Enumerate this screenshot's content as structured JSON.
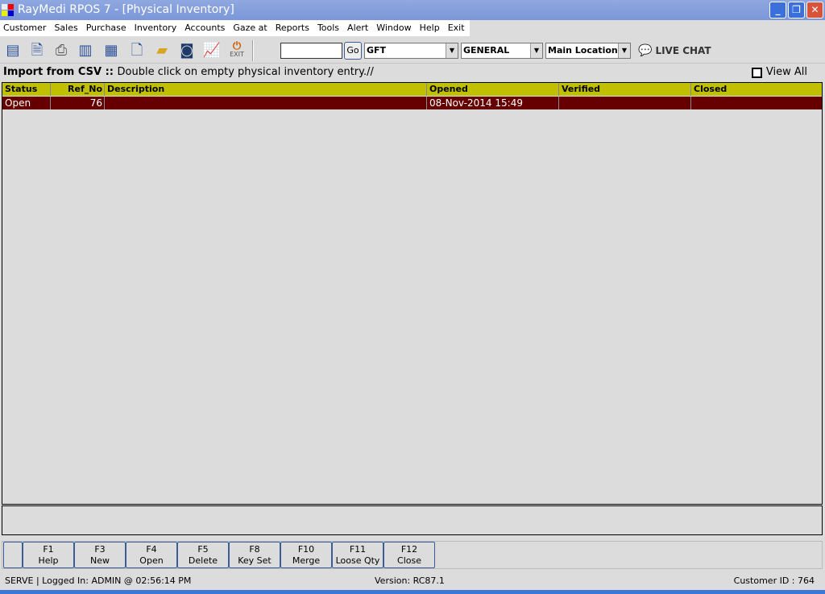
{
  "window": {
    "title": "RayMedi RPOS 7 - [Physical Inventory]"
  },
  "menu": [
    "Customer",
    "Sales",
    "Purchase",
    "Inventory",
    "Accounts",
    "Gaze at",
    "Reports",
    "Tools",
    "Alert",
    "Window",
    "Help",
    "Exit"
  ],
  "toolbar": {
    "exit_label": "EXIT",
    "search_value": "",
    "go_label": "Go",
    "combo1": "GFT",
    "combo2": "GENERAL",
    "combo3": "Main Location",
    "live_chat": "LIVE CHAT"
  },
  "info": {
    "text": "Import from CSV :: ",
    "hint": "Double click on empty physical inventory entry.//",
    "view_all": "View All"
  },
  "table": {
    "columns": [
      "Status",
      "Ref_No",
      "Description",
      "Opened",
      "Verified",
      "Closed"
    ],
    "rows": [
      {
        "status": "Open",
        "ref_no": "76",
        "description": "",
        "opened": "08-Nov-2014 15:49",
        "verified": "",
        "closed": ""
      }
    ]
  },
  "fkeys": [
    {
      "key": "F1",
      "label": "Help"
    },
    {
      "key": "F3",
      "label": "New"
    },
    {
      "key": "F4",
      "label": "Open"
    },
    {
      "key": "F5",
      "label": "Delete"
    },
    {
      "key": "F8",
      "label": "Key Set"
    },
    {
      "key": "F10",
      "label": "Merge"
    },
    {
      "key": "F11",
      "label": "Loose Qty"
    },
    {
      "key": "F12",
      "label": "Close"
    }
  ],
  "status": {
    "left": "SERVE |  Logged In: ADMIN  @ 02:56:14 PM",
    "version": "Version: RC87.1",
    "customer": "Customer ID : 764"
  }
}
